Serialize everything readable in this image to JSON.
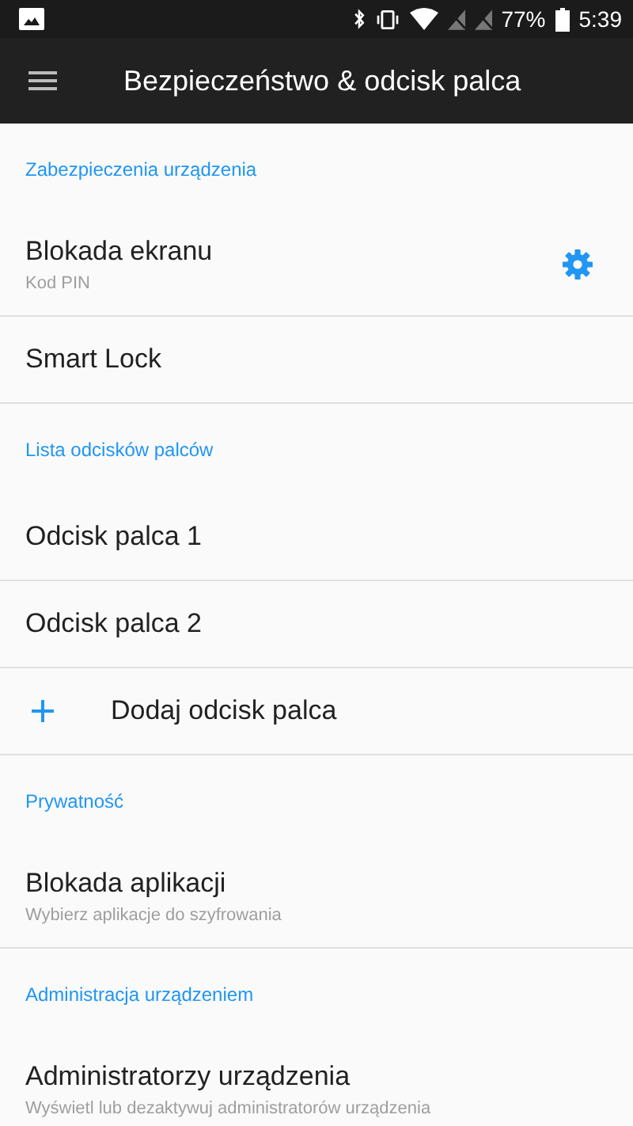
{
  "status_bar": {
    "battery_text": "77%",
    "time": "5:39"
  },
  "toolbar": {
    "title": "Bezpieczeństwo & odcisk palca"
  },
  "sections": [
    {
      "header": "Zabezpieczenia urządzenia",
      "items": [
        {
          "kind": "two_line",
          "title": "Blokada ekranu",
          "subtitle": "Kod PIN",
          "settings_icon": true
        },
        {
          "kind": "single",
          "title": "Smart Lock"
        }
      ]
    },
    {
      "header": "Lista odcisków palców",
      "items": [
        {
          "kind": "single",
          "title": "Odcisk palca 1"
        },
        {
          "kind": "single",
          "title": "Odcisk palca 2"
        },
        {
          "kind": "add",
          "title": "Dodaj odcisk palca"
        }
      ]
    },
    {
      "header": "Prywatność",
      "items": [
        {
          "kind": "two_line",
          "title": "Blokada aplikacji",
          "subtitle": "Wybierz aplikacje do szyfrowania"
        }
      ]
    },
    {
      "header": "Administracja urządzeniem",
      "items": [
        {
          "kind": "two_line",
          "title": "Administratorzy urządzenia",
          "subtitle": "Wyświetl lub dezaktywuj administratorów urządzenia"
        }
      ]
    }
  ]
}
